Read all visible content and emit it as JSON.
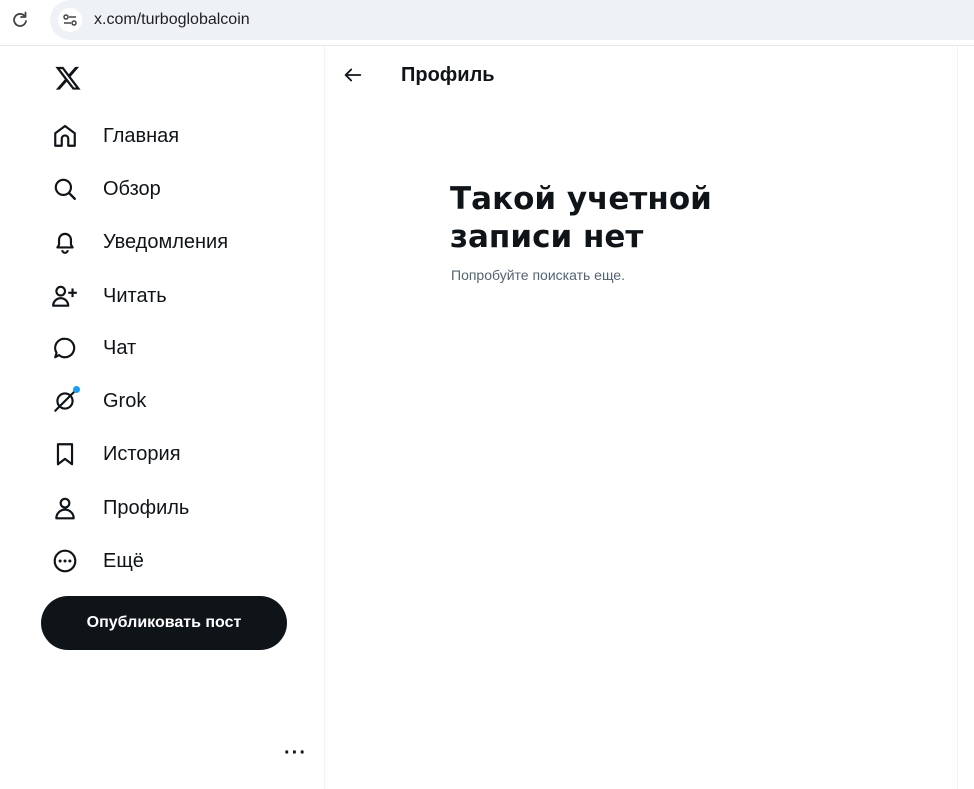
{
  "browser": {
    "url": "x.com/turboglobalcoin"
  },
  "sidebar": {
    "items": [
      {
        "label": "Главная",
        "icon": "home-icon"
      },
      {
        "label": "Обзор",
        "icon": "search-icon"
      },
      {
        "label": "Уведомления",
        "icon": "bell-icon"
      },
      {
        "label": "Читать",
        "icon": "follow-icon"
      },
      {
        "label": "Чат",
        "icon": "chat-icon"
      },
      {
        "label": "Grok",
        "icon": "grok-icon"
      },
      {
        "label": "История",
        "icon": "bookmark-icon"
      },
      {
        "label": "Профиль",
        "icon": "profile-icon"
      },
      {
        "label": "Ещё",
        "icon": "more-icon"
      }
    ],
    "post_button": "Опубликовать пост",
    "more_dots": "···"
  },
  "main": {
    "header_title": "Профиль",
    "empty_title": "Такой учетной записи нет",
    "empty_subtitle": "Попробуйте поискать еще."
  },
  "colors": {
    "text": "#0f1419",
    "secondary": "#536471",
    "accent": "#1d9bf0",
    "button_bg": "#0f1419"
  }
}
